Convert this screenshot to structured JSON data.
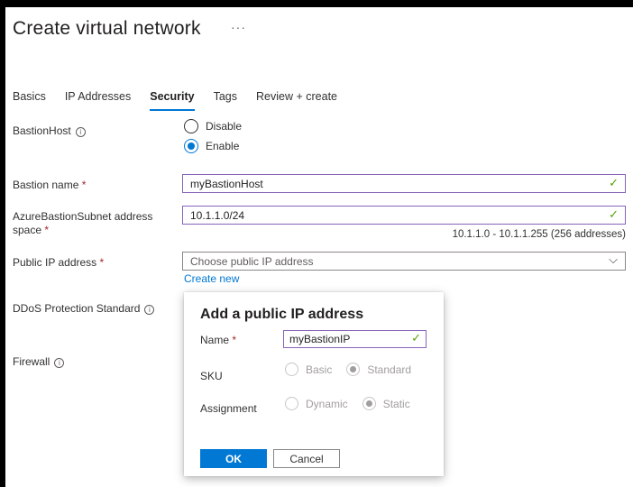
{
  "header": {
    "title": "Create virtual network",
    "more": "···"
  },
  "tabs": [
    {
      "label": "Basics"
    },
    {
      "label": "IP Addresses"
    },
    {
      "label": "Security",
      "active": true
    },
    {
      "label": "Tags"
    },
    {
      "label": "Review + create"
    }
  ],
  "bastion_host": {
    "label": "BastionHost",
    "info": "i",
    "options": {
      "disable": "Disable",
      "enable": "Enable"
    },
    "selected": "Enable"
  },
  "bastion_name": {
    "label": "Bastion name",
    "required": "*",
    "value": "myBastionHost",
    "valid_icon": "✓"
  },
  "subnet": {
    "label_line1": "AzureBastionSubnet address",
    "label_line2": "space",
    "required": "*",
    "value": "10.1.1.0/24",
    "valid_icon": "✓",
    "hint": "10.1.1.0 - 10.1.1.255 (256 addresses)"
  },
  "public_ip": {
    "label": "Public IP address",
    "required": "*",
    "placeholder": "Choose public IP address",
    "chevron": "⌵",
    "create_new": "Create new"
  },
  "ddos": {
    "label": "DDoS Protection Standard",
    "info": "i"
  },
  "firewall": {
    "label": "Firewall",
    "info": "i"
  },
  "popup": {
    "title": "Add a public IP address",
    "name_label": "Name",
    "required": "*",
    "name_value": "myBastionIP",
    "valid_icon": "✓",
    "sku_label": "SKU",
    "sku_options": {
      "basic": "Basic",
      "standard": "Standard"
    },
    "sku_selected": "Standard",
    "assignment_label": "Assignment",
    "assignment_options": {
      "dynamic": "Dynamic",
      "static": "Static"
    },
    "assignment_selected": "Static",
    "ok": "OK",
    "cancel": "Cancel"
  },
  "colors": {
    "accent": "#0078d4",
    "valid": "#57a300",
    "required": "#a4262c",
    "focus_border": "#8764b8"
  }
}
